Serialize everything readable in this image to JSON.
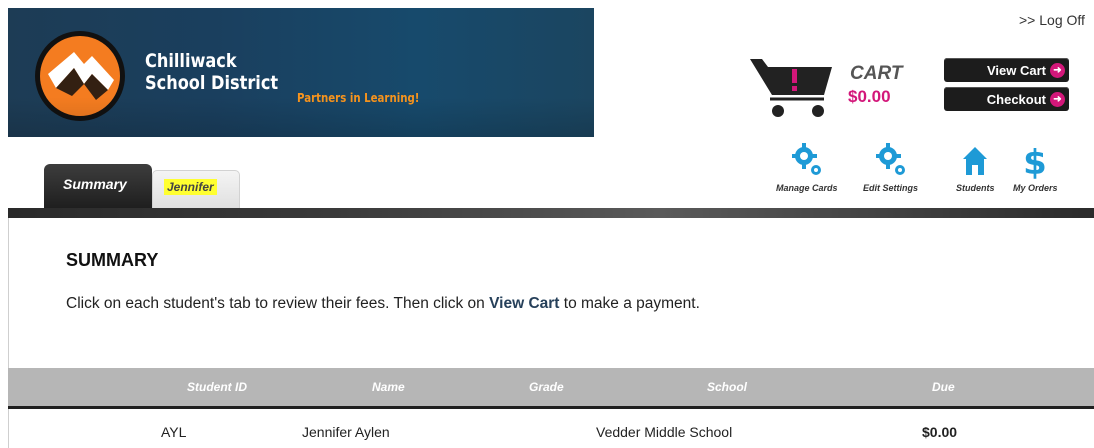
{
  "header": {
    "district_line1": "Chilliwack",
    "district_line2": "School District",
    "tagline": "Partners in Learning!",
    "logoff": ">> Log Off"
  },
  "cart": {
    "label": "CART",
    "total": "$0.00",
    "view_cart": "View Cart",
    "checkout": "Checkout",
    "icon": "shopping-cart-icon"
  },
  "tools": [
    {
      "label": "Manage Cards",
      "icon": "gears-icon"
    },
    {
      "label": "Edit Settings",
      "icon": "gears-icon"
    },
    {
      "label": "Students",
      "icon": "house-icon"
    },
    {
      "label": "My Orders",
      "icon": "dollar-icon"
    }
  ],
  "tabs": {
    "summary": "Summary",
    "student": "Jennifer"
  },
  "main": {
    "title": "SUMMARY",
    "instruction_pre": "Click on each student's tab to review their fees. Then click on ",
    "instruction_link": "View Cart",
    "instruction_post": " to make a payment."
  },
  "table": {
    "columns": [
      "Student ID",
      "Name",
      "Grade",
      "School",
      "Due"
    ],
    "rows": [
      {
        "student_id": "AYL",
        "name": "Jennifer Aylen",
        "grade": "",
        "school": "Vedder Middle School",
        "due": "$0.00"
      }
    ]
  },
  "colors": {
    "accent": "#d3177a",
    "banner": "#1a3f5e",
    "tagline": "#f7941d",
    "icon_blue": "#1e9ad6"
  }
}
